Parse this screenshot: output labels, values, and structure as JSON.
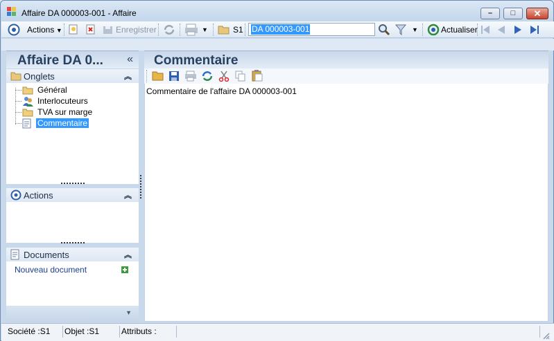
{
  "window": {
    "title": "Affaire DA 000003-001 -  Affaire"
  },
  "toolbar": {
    "actions_label": "Actions",
    "save_label": "Enregistrer",
    "company_label": "S1",
    "search_value": "DA 000003-001",
    "refresh_label": "Actualiser"
  },
  "left_panel": {
    "title": "Affaire DA 0...",
    "collapse_glyph": "«",
    "tabs_section": {
      "label": "Onglets",
      "items": [
        {
          "label": "Général",
          "icon": "folder-icon"
        },
        {
          "label": "Interlocuteurs",
          "icon": "contacts-icon"
        },
        {
          "label": "TVA sur marge",
          "icon": "folder-icon"
        },
        {
          "label": "Commentaire",
          "icon": "document-icon",
          "selected": true
        }
      ]
    },
    "actions_section": {
      "label": "Actions"
    },
    "documents_section": {
      "label": "Documents",
      "new_document_label": "Nouveau document"
    }
  },
  "main": {
    "title": "Commentaire",
    "comment_text": "Commentaire de l'affaire DA 000003-001"
  },
  "statusbar": {
    "company": "Société :S1",
    "object": "Objet :S1",
    "attributes": "Attributs :"
  },
  "colors": {
    "accent": "#3399ff",
    "header_text": "#26405f",
    "frame": "#c9d9ec",
    "close_button": "#c8452e"
  }
}
